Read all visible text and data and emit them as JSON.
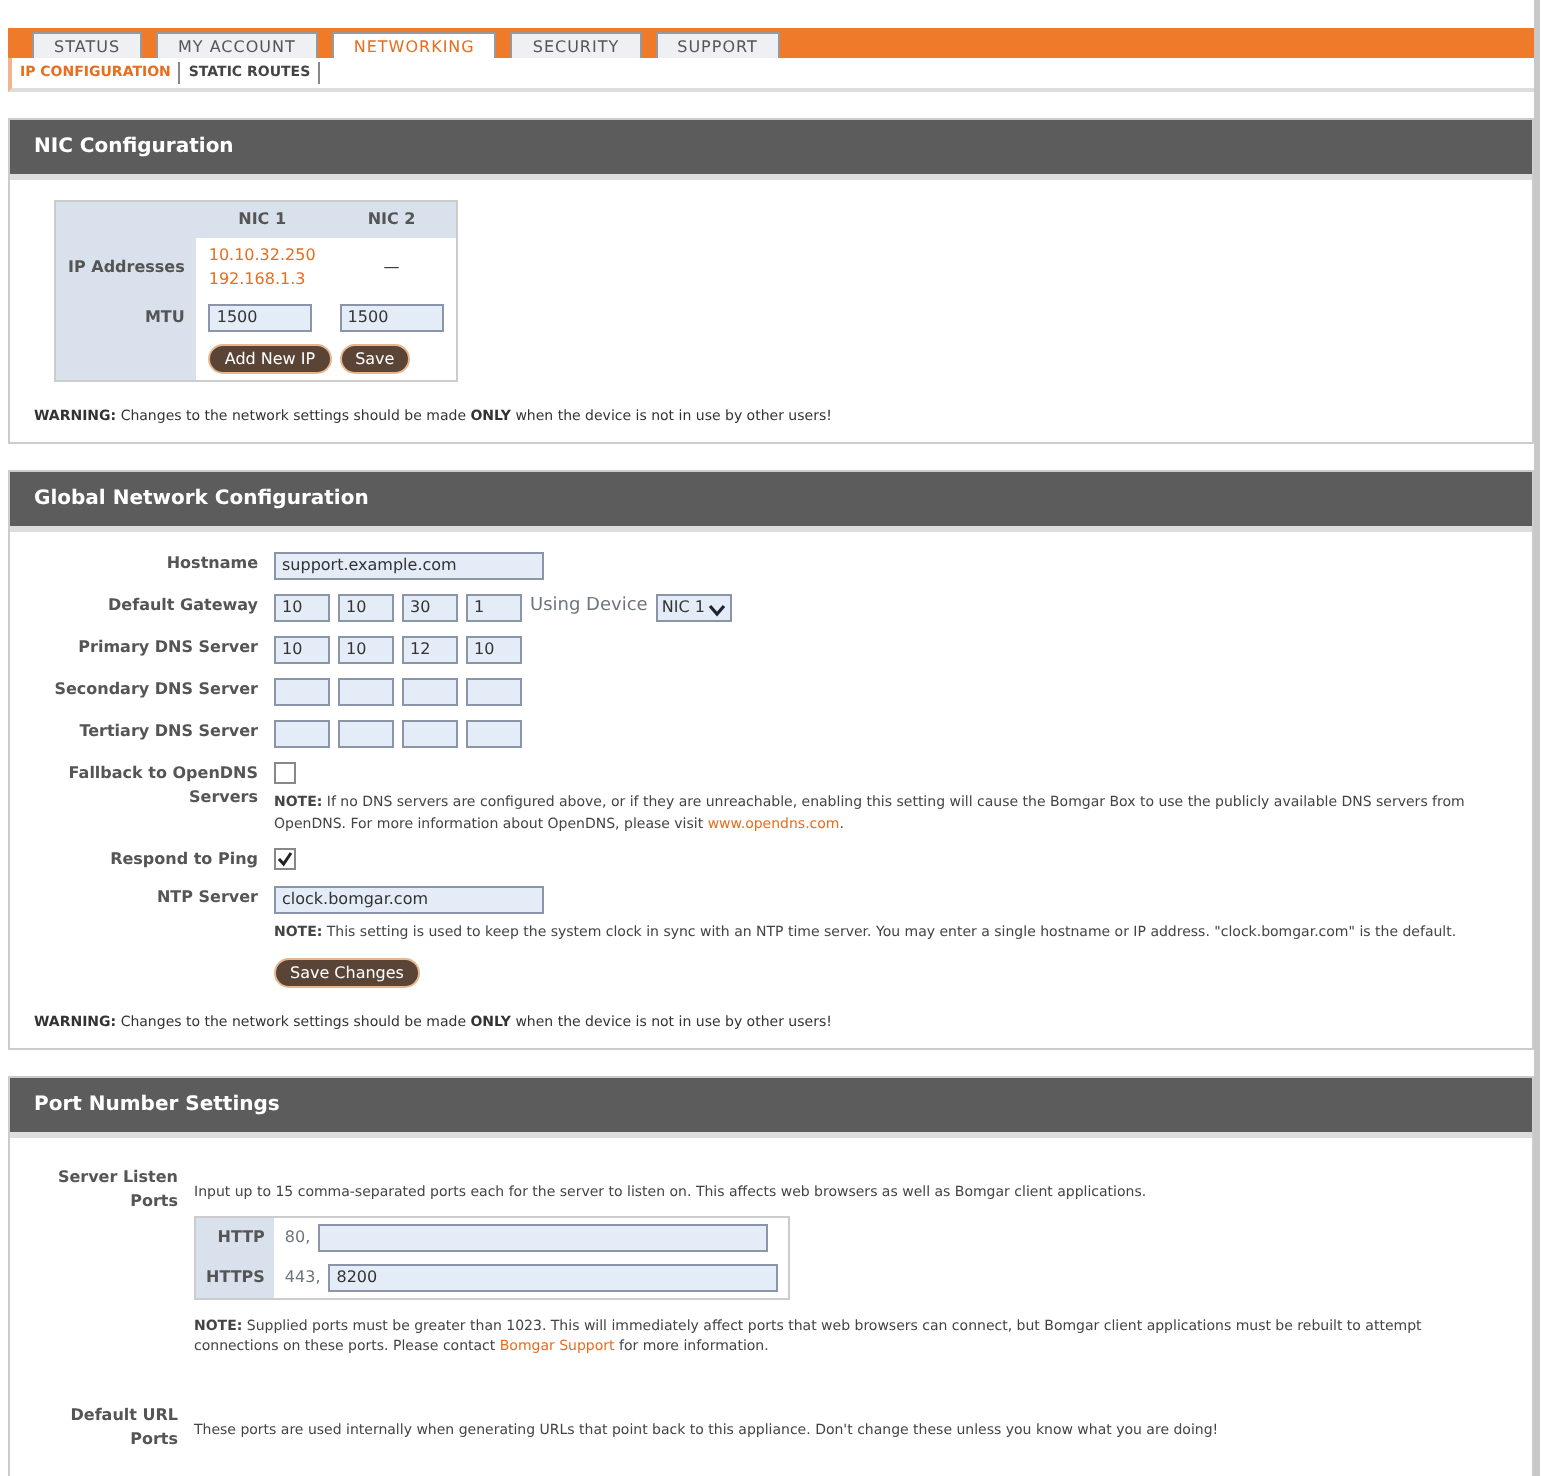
{
  "tabs": [
    {
      "label": "STATUS",
      "selected": false
    },
    {
      "label": "MY ACCOUNT",
      "selected": false
    },
    {
      "label": "NETWORKING",
      "selected": true
    },
    {
      "label": "SECURITY",
      "selected": false
    },
    {
      "label": "SUPPORT",
      "selected": false
    }
  ],
  "subtabs": [
    {
      "label": "IP CONFIGURATION",
      "selected": true
    },
    {
      "label": "STATIC ROUTES",
      "selected": false
    }
  ],
  "nic": {
    "title": "NIC Configuration",
    "columns": [
      "NIC 1",
      "NIC 2"
    ],
    "ip_label": "IP Addresses",
    "ip_values": [
      [
        "10.10.32.250",
        "192.168.1.3"
      ],
      [
        "—"
      ]
    ],
    "mtu_label": "MTU",
    "mtu_values": [
      "1500",
      "1500"
    ],
    "buttons": [
      "Add New IP",
      "Save"
    ],
    "warning": "**WARNING:** Changes to the network settings should be made **ONLY** when the device is not in use by other users!"
  },
  "global": {
    "title": "Global Network Configuration",
    "fields": [
      {
        "kind": "text",
        "label": "Hostname",
        "value": "support.example.com"
      },
      {
        "kind": "ip",
        "label": "Default Gateway",
        "octets": [
          "10",
          "10",
          "30",
          "1"
        ],
        "device_label": "Using Device",
        "device_value": "NIC 1"
      },
      {
        "kind": "ip",
        "label": "Primary DNS Server",
        "octets": [
          "10",
          "10",
          "12",
          "10"
        ]
      },
      {
        "kind": "ip",
        "label": "Secondary DNS Server"
      },
      {
        "kind": "ip",
        "label": "Tertiary DNS Server"
      },
      {
        "kind": "checkbox",
        "label": "Fallback to OpenDNS Servers",
        "checked": false,
        "note": {
          "before": "**NOTE:** If no DNS servers are configured above, or if they are unreachable, enabling this setting will cause the Bomgar Box to use the publicly available DNS servers from OpenDNS. For more information about OpenDNS, please visit ",
          "link": "www.opendns.com",
          "after": "."
        }
      },
      {
        "kind": "checkbox",
        "label": "Respond to Ping",
        "checked": true
      },
      {
        "kind": "text",
        "label": "NTP Server",
        "value": "clock.bomgar.com",
        "note": {
          "before": "**NOTE:** This setting is used to keep the system clock in sync with an NTP time server. You may enter a single hostname or IP address. \"clock.bomgar.com\" is the default."
        }
      }
    ],
    "button": "Save Changes",
    "warning": "**WARNING:** Changes to the network settings should be made **ONLY** when the device is not in use by other users!"
  },
  "ports": {
    "title": "Port Number Settings",
    "settings": [
      {
        "label": "Server Listen Ports",
        "description": "Input up to 15 comma-separated ports each for the server to listen on. This affects web browsers as well as Bomgar client applications.",
        "ports": [
          {
            "label": "HTTP",
            "prefix": "80,"
          },
          {
            "label": "HTTPS",
            "prefix": "443,",
            "value": "8200"
          }
        ],
        "note": {
          "before": "**NOTE:** Supplied ports must be greater than 1023. This will immediately affect ports that web browsers can connect, but Bomgar client applications must be rebuilt to attempt connections on these ports. Please contact ",
          "link": "Bomgar Support",
          "after": " for more information."
        }
      },
      {
        "label": "Default URL Ports",
        "description": "These ports are used internally when generating URLs that point back to this appliance. Don't change these unless you know what you are doing!"
      }
    ]
  }
}
